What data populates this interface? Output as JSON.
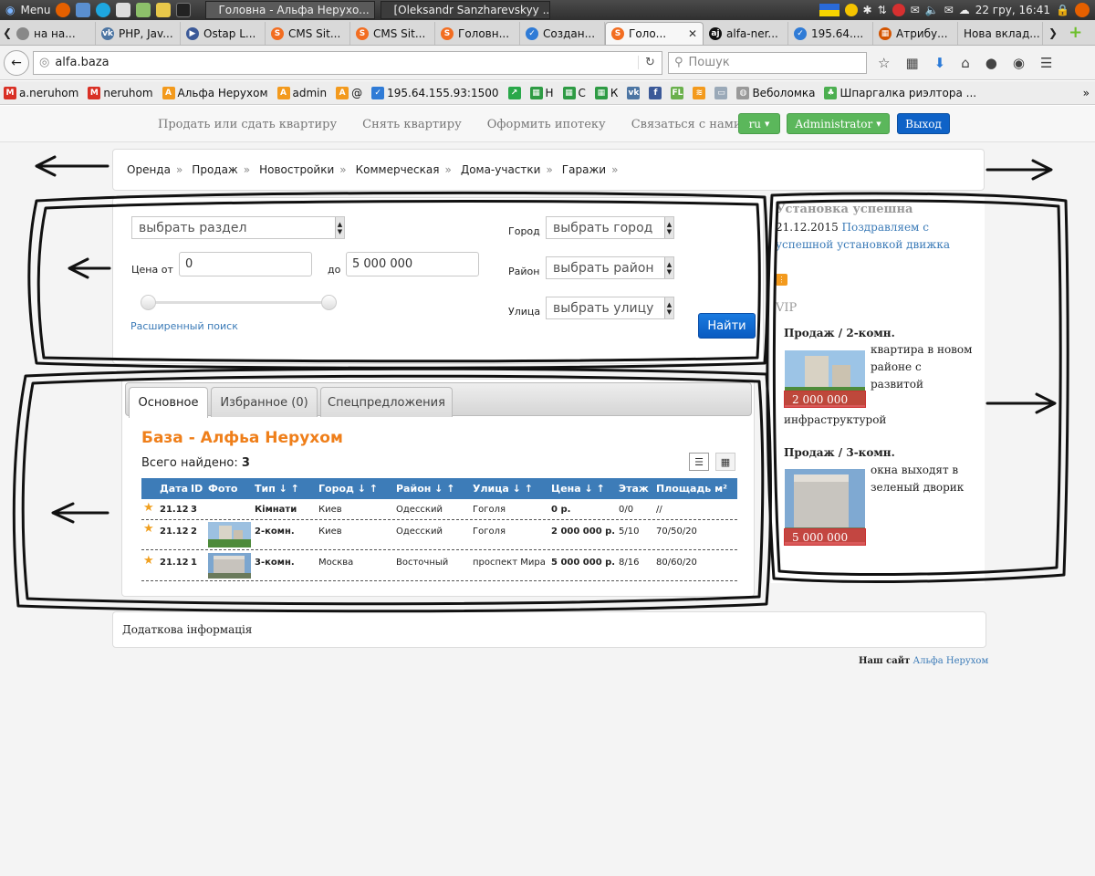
{
  "os_panel": {
    "menu_label": "Menu",
    "tasks": [
      {
        "label": "Головна - Альфа Нерухо..."
      },
      {
        "label": "[Oleksandr Sanzharevskyy ..."
      }
    ],
    "clock": "22 гру, 16:41"
  },
  "browser_tabs": [
    {
      "label": "на на...",
      "icon": "generic-icon"
    },
    {
      "label": "PHP, Jav...",
      "icon": "vk-icon"
    },
    {
      "label": "Ostap L...",
      "icon": "play-icon"
    },
    {
      "label": "CMS Sit...",
      "icon": "s-icon"
    },
    {
      "label": "CMS Sit...",
      "icon": "s-icon"
    },
    {
      "label": "Головн...",
      "icon": "s-icon"
    },
    {
      "label": "Создан...",
      "icon": "check-icon"
    },
    {
      "label": "Голо...",
      "icon": "s-icon",
      "active": true
    },
    {
      "label": "alfa-ner...",
      "icon": "aj-icon"
    },
    {
      "label": "195.64....",
      "icon": "check-icon"
    },
    {
      "label": "Атрибу...",
      "icon": "grid-icon"
    },
    {
      "label": "Нова вклад...",
      "icon": "none"
    }
  ],
  "address": {
    "url": "alfa.baza",
    "search_placeholder": "Пошук"
  },
  "bookmarks": [
    {
      "label": "a.neruhom",
      "icon": "gmail-icon"
    },
    {
      "label": "neruhom",
      "icon": "gmail-icon"
    },
    {
      "label": "Альфа Нерухом",
      "icon": "a-icon"
    },
    {
      "label": "admin",
      "icon": "a-icon"
    },
    {
      "label": "@",
      "icon": "a-icon"
    },
    {
      "label": "195.64.155.93:1500",
      "icon": "check-icon"
    },
    {
      "label": "",
      "icon": "chart-icon"
    },
    {
      "label": "Н",
      "icon": "sheet-icon"
    },
    {
      "label": "С",
      "icon": "sheet-icon"
    },
    {
      "label": "К",
      "icon": "sheet-icon"
    },
    {
      "label": "",
      "icon": "vk-icon"
    },
    {
      "label": "",
      "icon": "facebook-icon"
    },
    {
      "label": "",
      "icon": "fl-icon"
    },
    {
      "label": "",
      "icon": "rss-icon"
    },
    {
      "label": "",
      "icon": "folder-icon"
    },
    {
      "label": "Веболомка",
      "icon": "globe-icon"
    },
    {
      "label": "Шпаргалка риэлтора ...",
      "icon": "leaf-icon"
    }
  ],
  "top_menu": {
    "links": [
      "Продать или сдать квартиру",
      "Снять квартиру",
      "Оформить ипотеку",
      "Связаться с нами"
    ],
    "lang_button": "ru",
    "admin_button": "Administrator",
    "logout_button": "Выход"
  },
  "categories": [
    "Оренда",
    "Продаж",
    "Новостройки",
    "Коммерческая",
    "Дома-участки",
    "Гаражи"
  ],
  "search": {
    "section_select": "выбрать раздел",
    "price_from_label": "Цена от",
    "price_from_value": "0",
    "price_to_label": "до",
    "price_to_value": "5 000 000",
    "city_label": "Город",
    "city_select": "выбрать город",
    "district_label": "Район",
    "district_select": "выбрать район",
    "street_label": "Улица",
    "street_select": "выбрать улицу",
    "advanced_link": "Расширенный поиск",
    "find_button": "Найти"
  },
  "results": {
    "tabs": [
      "Основное",
      "Избранное (0)",
      "Спецпредложения"
    ],
    "title": "База - Алфьа Нерухом",
    "count_label": "Всего найдено:",
    "count_value": "3",
    "columns": [
      "Дата",
      "ID",
      "Фото",
      "Тип ↓ ↑",
      "Город ↓ ↑",
      "Район ↓ ↑",
      "Улица ↓ ↑",
      "Цена ↓ ↑",
      "Этаж",
      "Площадь м²"
    ],
    "rows": [
      {
        "date": "21.12",
        "id": "3",
        "type": "Кімнати",
        "city": "Киев",
        "district": "Одесский",
        "street": "Гоголя",
        "price": "0 р.",
        "floor": "0/0",
        "area": "//",
        "photo": false
      },
      {
        "date": "21.12",
        "id": "2",
        "type": "2-комн.",
        "city": "Киев",
        "district": "Одесский",
        "street": "Гоголя",
        "price": "2 000 000 р.",
        "floor": "5/10",
        "area": "70/50/20",
        "photo": true
      },
      {
        "date": "21.12",
        "id": "1",
        "type": "3-комн.",
        "city": "Москва",
        "district": "Восточный",
        "street": "проспект Мира",
        "price": "5 000 000 р.",
        "floor": "8/16",
        "area": "80/60/20",
        "photo": true
      }
    ]
  },
  "footer": {
    "extra_info": "Додаткова інформація",
    "site_label": "Наш сайт",
    "site_link": "Альфа Нерухом"
  },
  "sidebar": {
    "news_title": "Установка успешна",
    "news_date": "21.12.2015",
    "news_link": "Поздравляем с успешной установкой движка",
    "vip_title": "VIP",
    "vip_items": [
      {
        "heading": "Продаж / 2-комн.",
        "price": "2 000 000",
        "text": "квартира в новом районе с развитой",
        "text_cont": "инфраструктурой"
      },
      {
        "heading": "Продаж / 3-комн.",
        "price": "5 000 000",
        "text": "окна выходят в зеленый дворик",
        "text_cont": ""
      }
    ]
  },
  "colors": {
    "accent_orange": "#ef7f1a",
    "table_header_blue": "#3d7cb8",
    "button_green": "#5bb75b",
    "button_blue": "#0e62c7",
    "vip_price_red": "#d23c3c"
  }
}
